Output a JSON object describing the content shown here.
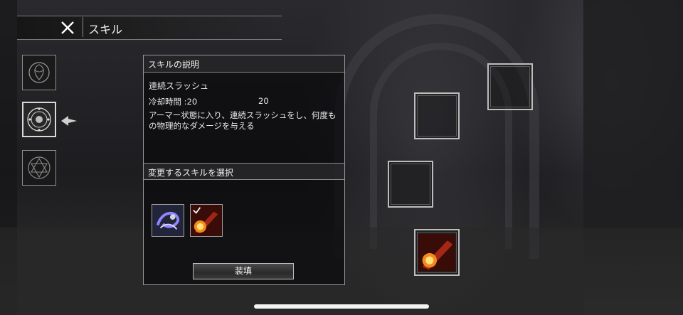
{
  "header": {
    "title": "スキル"
  },
  "sidebar": {
    "icons": [
      {
        "name": "rose-emblem-icon"
      },
      {
        "name": "circular-rune-icon"
      },
      {
        "name": "hexagram-seal-icon"
      }
    ]
  },
  "panel": {
    "description_header": "スキルの説明",
    "skill_name": "連続スラッシュ",
    "cooldown_label": "冷却時間 :20",
    "cooldown_value": "20",
    "description": "アーマー状態に入り、連続スラッシュをし、何度もの物理的なダメージを与える",
    "select_header": "変更するスキルを選択",
    "choices": [
      {
        "name": "purple-slash-skill-icon"
      },
      {
        "name": "fireball-skill-icon"
      }
    ],
    "equip_label": "装填"
  },
  "colors": {
    "fire": "#e8481c",
    "slash": "#6e63f0",
    "border": "#bdbdbd"
  }
}
